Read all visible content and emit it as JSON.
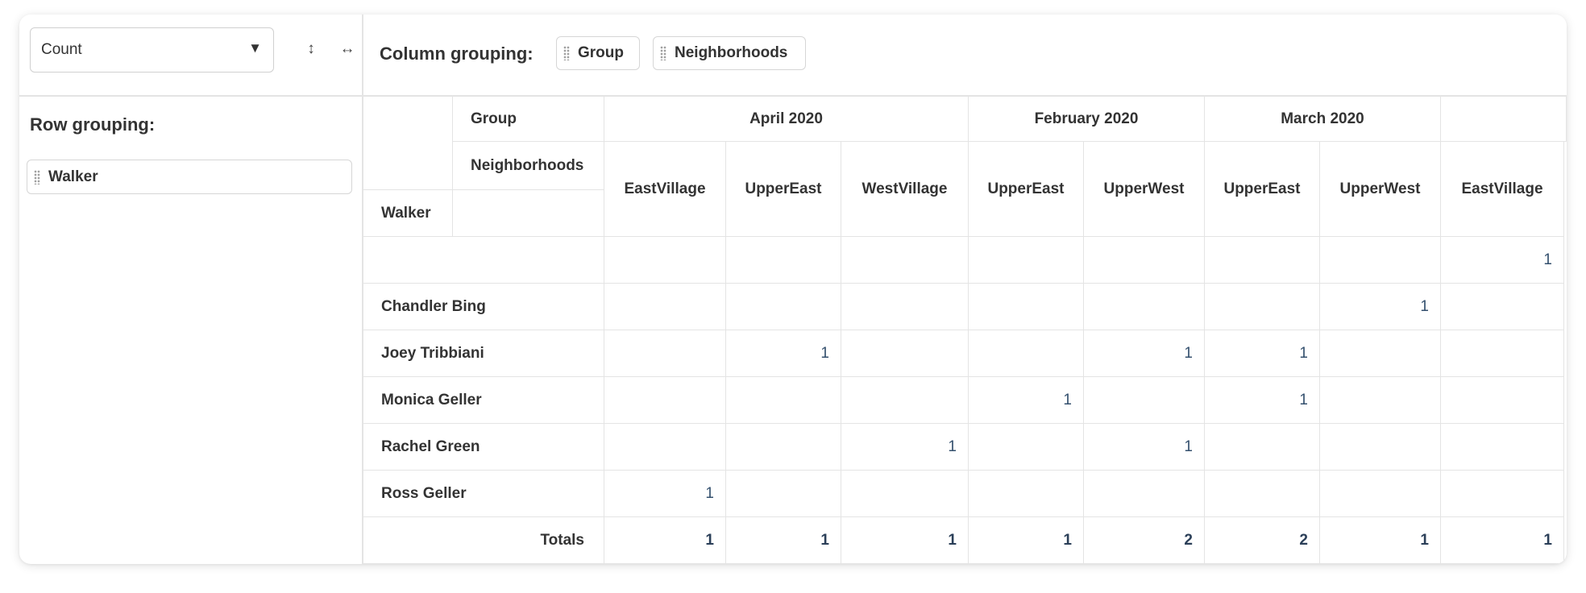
{
  "aggregator": {
    "selected": "Count",
    "caret": "▼",
    "sort_rows_icon": "↕",
    "sort_cols_icon": "↔"
  },
  "row_grouping": {
    "title": "Row grouping:",
    "chips": [
      "Walker"
    ]
  },
  "column_grouping": {
    "title": "Column grouping:",
    "chips": [
      "Group",
      "Neighborhoods"
    ]
  },
  "pivot": {
    "axis_labels": {
      "group": "Group",
      "neighborhoods": "Neighborhoods",
      "walker": "Walker"
    },
    "groups": [
      "April 2020",
      "February 2020",
      "March 2020"
    ],
    "columns": [
      "EastVillage",
      "UpperEast",
      "WestVillage",
      "UpperEast",
      "UpperWest",
      "UpperEast",
      "UpperWest",
      "EastVillage"
    ],
    "rows": [
      {
        "label": "",
        "values": [
          "",
          "",
          "",
          "",
          "",
          "",
          "",
          "1"
        ]
      },
      {
        "label": "Chandler Bing",
        "values": [
          "",
          "",
          "",
          "",
          "",
          "",
          "1",
          ""
        ]
      },
      {
        "label": "Joey Tribbiani",
        "values": [
          "",
          "1",
          "",
          "",
          "1",
          "1",
          "",
          ""
        ]
      },
      {
        "label": "Monica Geller",
        "values": [
          "",
          "",
          "",
          "1",
          "",
          "1",
          "",
          ""
        ]
      },
      {
        "label": "Rachel Green",
        "values": [
          "",
          "",
          "1",
          "",
          "1",
          "",
          "",
          ""
        ]
      },
      {
        "label": "Ross Geller",
        "values": [
          "1",
          "",
          "",
          "",
          "",
          "",
          "",
          ""
        ]
      }
    ],
    "totals_label": "Totals",
    "totals": [
      "1",
      "1",
      "1",
      "1",
      "2",
      "2",
      "1",
      "1"
    ]
  }
}
